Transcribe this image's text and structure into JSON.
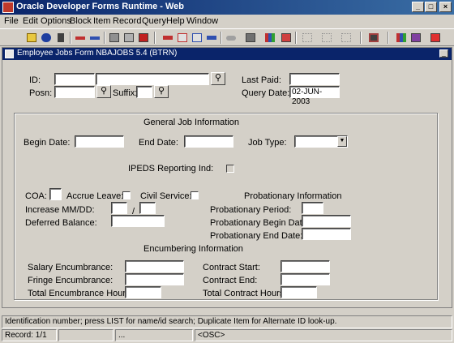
{
  "window": {
    "title": "Oracle Developer Forms Runtime - Web",
    "minimize": "_",
    "maximize": "□",
    "close": "×"
  },
  "menu": [
    "File",
    "Edit",
    "Options",
    "Block",
    "Item",
    "Record",
    "Query",
    "Help",
    "Window"
  ],
  "toolbar_icons": [
    "save-icon",
    "rollback-icon",
    "exit-icon",
    "insert-record-icon",
    "delete-record-icon",
    "print-icon",
    "enter-query-icon",
    "execute-query-icon",
    "previous-block-icon",
    "previous-record-icon",
    "next-record-icon",
    "next-block-icon",
    "edit-icon",
    "lov-icon",
    "chart-icon",
    "help-icon",
    "tree-icon-1",
    "tree-icon-2",
    "tree-icon-3",
    "options-icon",
    "books-icon",
    "exit-door-icon"
  ],
  "form": {
    "title": "Employee Jobs Form  NBAJOBS  5.4  (BTRN)",
    "minimize": "_",
    "id_label": "ID:",
    "posn_label": "Posn:",
    "suffix_label": "Suffix:",
    "last_paid_label": "Last Paid:",
    "query_date_label": "Query Date:",
    "query_date_value": "02-JUN-2003",
    "lov_glyph": "⚲",
    "general_header": "General Job Information",
    "begin_date_label": "Begin Date:",
    "end_date_label": "End Date:",
    "job_type_label": "Job Type:",
    "dropdown_glyph": "▼",
    "ipeds_label": "IPEDS Reporting Ind:",
    "coa_label": "COA:",
    "accrue_leave_label": "Accrue Leave:",
    "civil_service_label": "Civil Service:",
    "probationary_header": "Probationary Information",
    "increase_label": "Increase MM/DD:",
    "increase_sep": "/",
    "deferred_label": "Deferred Balance:",
    "prob_period_label": "Probationary Period:",
    "prob_begin_label": "Probationary Begin Date:",
    "prob_end_label": "Probationary End Date:",
    "encumbering_header": "Encumbering Information",
    "salary_enc_label": "Salary Encumbrance:",
    "fringe_enc_label": "Fringe Encumbrance:",
    "total_enc_hours_label": "Total Encumbrance Hours:",
    "contract_start_label": "Contract Start:",
    "contract_end_label": "Contract End:",
    "total_contract_hours_label": "Total Contract Hours:"
  },
  "status": {
    "hint": "Identification number; press LIST for name/id search; Duplicate Item for Alternate ID look-up.",
    "record": "Record: 1/1",
    "seg2": "...",
    "osc": "<OSC>"
  }
}
